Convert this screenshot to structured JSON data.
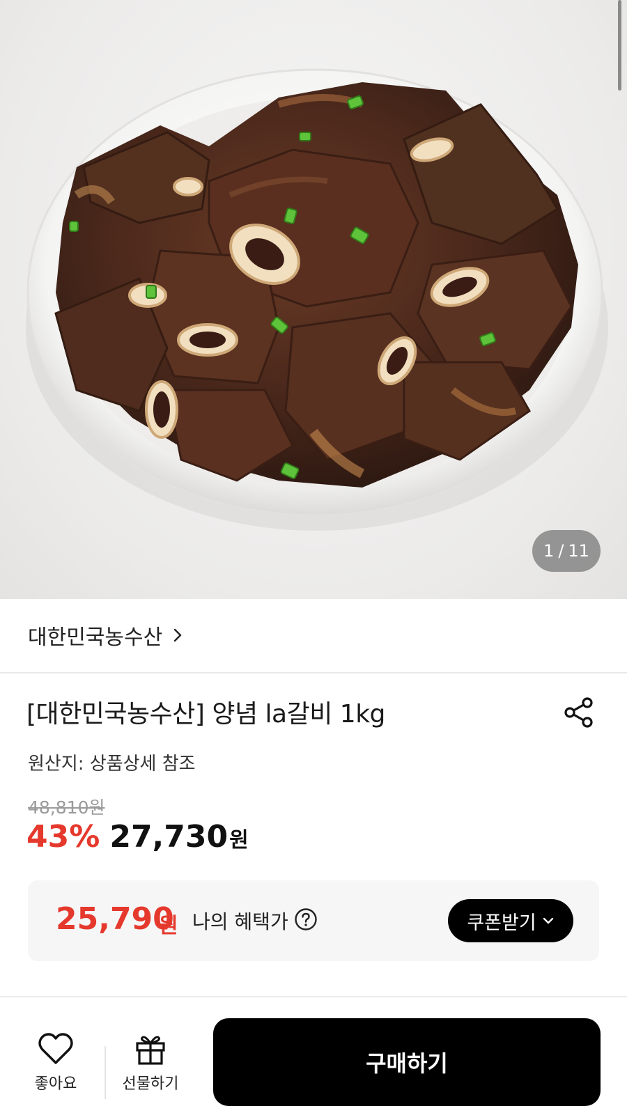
{
  "gallery": {
    "current": "1",
    "separator": "/",
    "total": "11"
  },
  "seller": {
    "name": "대한민국농수산",
    "chevron_icon": "chevron-right-icon"
  },
  "product": {
    "title": "[대한민국농수산] 양념 la갈비 1kg",
    "share_icon": "share-icon",
    "origin": "원산지: 상품상세 참조",
    "original_price": "48,810원",
    "discount_rate": "43%",
    "sale_price": "27,730",
    "price_unit": "원"
  },
  "benefit": {
    "price": "25,790",
    "unit": "원",
    "label": "나의 혜택가",
    "help_icon": "question-circle-icon",
    "coupon_button": "쿠폰받기",
    "coupon_chevron_icon": "chevron-down-icon"
  },
  "bottom_bar": {
    "like_label": "좋아요",
    "like_icon": "heart-icon",
    "gift_label": "선물하기",
    "gift_icon": "gift-icon",
    "buy_label": "구매하기"
  },
  "colors": {
    "accent_red": "#e5392d",
    "button_black": "#000000"
  }
}
